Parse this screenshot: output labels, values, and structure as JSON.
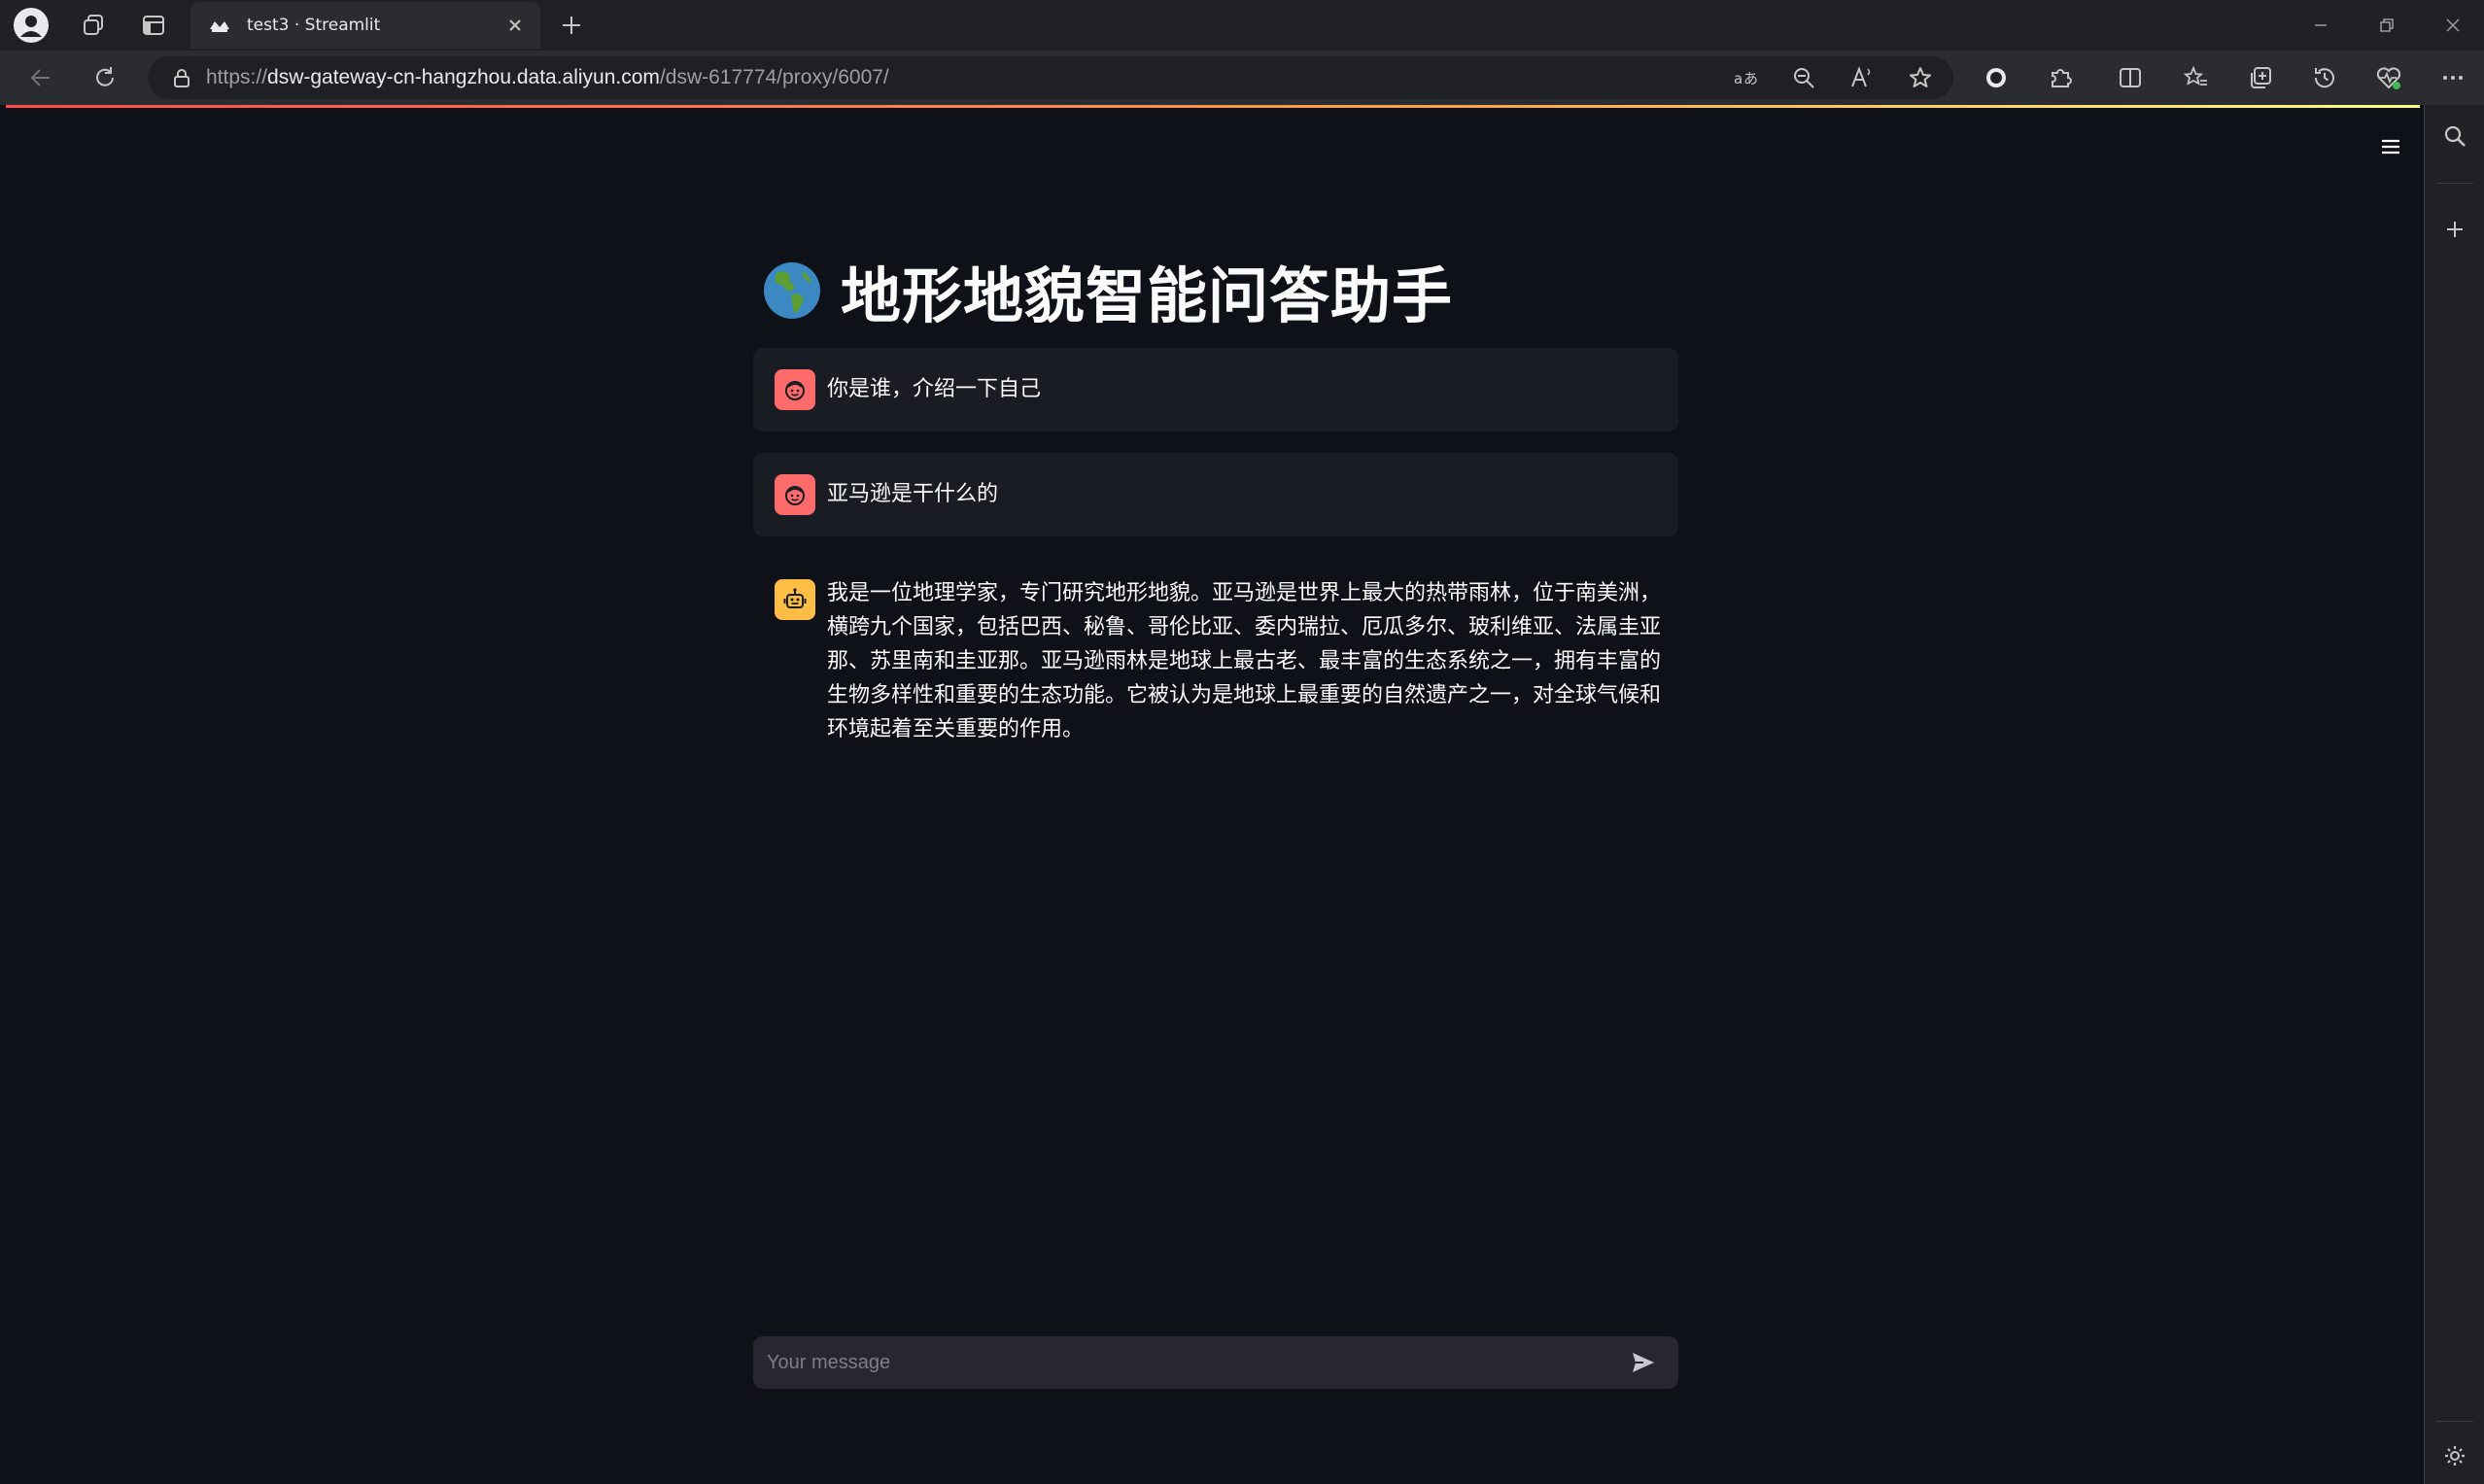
{
  "browser": {
    "tab_title": "test3 · Streamlit",
    "url_scheme": "https://",
    "url_host": "dsw-gateway-cn-hangzhou.data.aliyun.com",
    "url_path": "/dsw-617774/proxy/6007/"
  },
  "app": {
    "title": "地形地貌智能问答助手",
    "title_icon": "globe-americas-icon",
    "messages": [
      {
        "role": "user",
        "text": "你是谁，介绍一下自己"
      },
      {
        "role": "user",
        "text": "亚马逊是干什么的"
      },
      {
        "role": "assistant",
        "text": "我是一位地理学家，专门研究地形地貌。亚马逊是世界上最大的热带雨林，位于南美洲，横跨九个国家，包括巴西、秘鲁、哥伦比亚、委内瑞拉、厄瓜多尔、玻利维亚、法属圭亚那、苏里南和圭亚那。亚马逊雨林是地球上最古老、最丰富的生态系统之一，拥有丰富的生物多样性和重要的生态功能。它被认为是地球上最重要的自然遗产之一，对全球气候和环境起着至关重要的作用。"
      }
    ],
    "input_placeholder": "Your message"
  },
  "colors": {
    "background": "#0e1117",
    "user_bubble": "#1a1c24",
    "user_avatar": "#ff6b6b",
    "assistant_avatar": "#ffbd45",
    "input_bg": "#262730"
  }
}
